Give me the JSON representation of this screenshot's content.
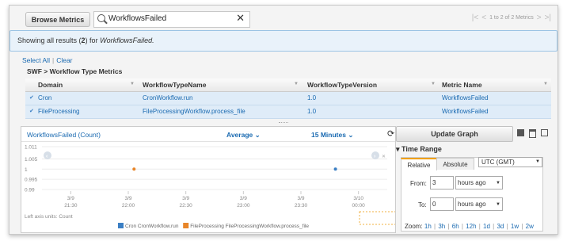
{
  "toolbar": {
    "browse_label": "Browse Metrics",
    "search_value": "WorkflowsFailed",
    "pager_text": "1 to 2 of 2 Metrics"
  },
  "info": {
    "prefix": "Showing all results (",
    "count": "2",
    "middle": ") for ",
    "query": "WorkflowsFailed."
  },
  "selection": {
    "select_all": "Select All",
    "separator": "|",
    "clear": "Clear"
  },
  "table": {
    "title": "SWF > Workflow Type Metrics",
    "headers": [
      "Domain",
      "WorkflowTypeName",
      "WorkflowTypeVersion",
      "Metric Name"
    ],
    "rows": [
      {
        "domain": "Cron",
        "type_name": "CronWorkflow.run",
        "version": "1.0",
        "metric": "WorkflowsFailed"
      },
      {
        "domain": "FileProcessing",
        "type_name": "FileProcessingWorkflow.process_file",
        "version": "1.0",
        "metric": "WorkflowsFailed"
      }
    ]
  },
  "chart_panel": {
    "title": "WorkflowsFailed (Count)",
    "statistic": "Average",
    "period": "15 Minutes",
    "units_note": "Left axis units: Count"
  },
  "chart_data": {
    "type": "scatter",
    "y_ticks": [
      "1.011",
      "1.005",
      "1",
      "0.995",
      "0.99"
    ],
    "x_ticks": [
      {
        "date": "3/9",
        "time": "21:30"
      },
      {
        "date": "3/9",
        "time": "22:00"
      },
      {
        "date": "3/9",
        "time": "22:30"
      },
      {
        "date": "3/9",
        "time": "23:00"
      },
      {
        "date": "3/9",
        "time": "23:30"
      },
      {
        "date": "3/10",
        "time": "00:00"
      }
    ],
    "ylim": [
      0.99,
      1.011
    ],
    "xlim_minutes_from_first_tick": [
      -15,
      165
    ],
    "series": [
      {
        "name": "Cron CronWorkflow.run",
        "color": "#3b7fc4",
        "points": [
          {
            "t": "23:48",
            "y": 1
          }
        ]
      },
      {
        "name": "FileProcessing FileProcessingWorkflow.process_file",
        "color": "#e8862a",
        "points": [
          {
            "t": "22:03",
            "y": 1
          }
        ]
      }
    ]
  },
  "right_panel": {
    "update_label": "Update Graph",
    "time_range_label": "Time Range",
    "tab_relative": "Relative",
    "tab_absolute": "Absolute",
    "timezone": "UTC (GMT)",
    "from_label": "From:",
    "from_value": "3",
    "from_unit": "hours ago",
    "to_label": "To:",
    "to_value": "0",
    "to_unit": "hours ago",
    "zoom_label": "Zoom:",
    "zoom_options": [
      "1h",
      "3h",
      "6h",
      "12h",
      "1d",
      "3d",
      "1w",
      "2w"
    ]
  }
}
